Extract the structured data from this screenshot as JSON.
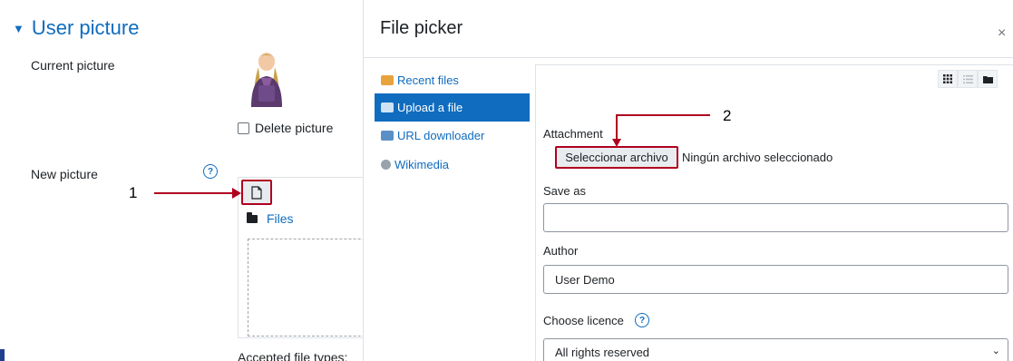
{
  "profile": {
    "section_title": "User picture",
    "current_picture_label": "Current picture",
    "delete_picture_label": "Delete picture",
    "new_picture_label": "New picture",
    "files_label": "Files",
    "accepted_types_label": "Accepted file types:"
  },
  "annotations": {
    "marker_1": "1",
    "marker_2": "2",
    "color": "#b00020"
  },
  "file_picker": {
    "title": "File picker",
    "close_glyph": "×",
    "repositories": [
      {
        "label": "Recent files",
        "icon": "recent-files-icon",
        "active": false
      },
      {
        "label": "Upload a file",
        "icon": "upload-icon",
        "active": true
      },
      {
        "label": "URL downloader",
        "icon": "url-downloader-icon",
        "active": false
      },
      {
        "label": "Wikimedia",
        "icon": "wikimedia-icon",
        "active": false
      }
    ],
    "view_modes": [
      "icons-view-icon",
      "list-view-icon",
      "tree-view-icon"
    ],
    "attachment_label": "Attachment",
    "choose_file_button": "Seleccionar archivo",
    "no_file_text": "Ningún archivo seleccionado",
    "save_as_label": "Save as",
    "save_as_value": "",
    "author_label": "Author",
    "author_value": "User Demo",
    "licence_label": "Choose licence",
    "licence_value": "All rights reserved"
  },
  "colors": {
    "accent": "#0f6cbf",
    "background": "#dde7f3"
  }
}
